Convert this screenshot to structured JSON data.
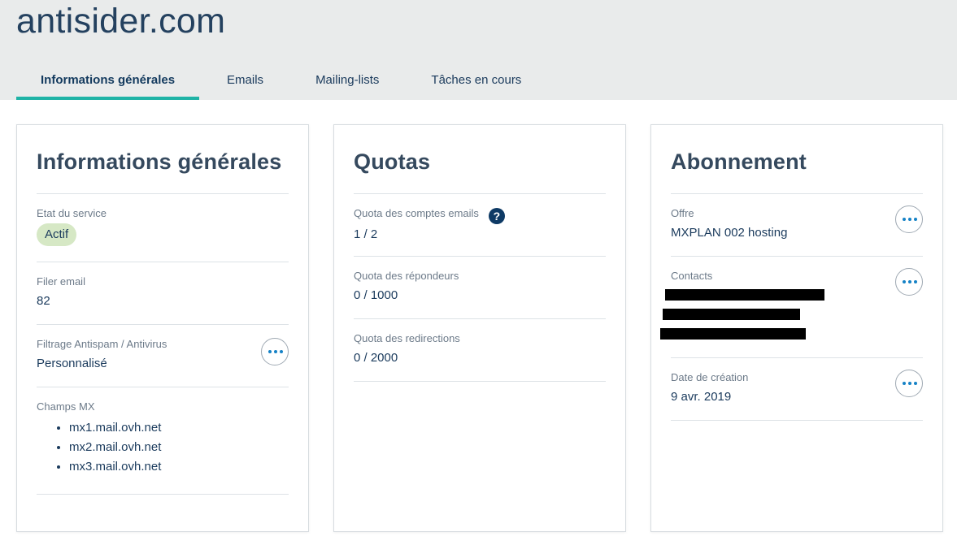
{
  "header": {
    "domain": "antisider.com",
    "tabs": [
      {
        "label": "Informations générales",
        "active": true
      },
      {
        "label": "Emails",
        "active": false
      },
      {
        "label": "Mailing-lists",
        "active": false
      },
      {
        "label": "Tâches en cours",
        "active": false
      }
    ]
  },
  "general": {
    "title": "Informations générales",
    "service_state": {
      "label": "Etat du service",
      "value": "Actif"
    },
    "filer": {
      "label": "Filer email",
      "value": "82"
    },
    "antispam": {
      "label": "Filtrage Antispam / Antivirus",
      "value": "Personnalisé"
    },
    "mx": {
      "label": "Champs MX",
      "values": [
        "mx1.mail.ovh.net",
        "mx2.mail.ovh.net",
        "mx3.mail.ovh.net"
      ]
    }
  },
  "quotas": {
    "title": "Quotas",
    "email_accounts": {
      "label": "Quota des comptes emails",
      "value": "1 / 2",
      "help": "?"
    },
    "responders": {
      "label": "Quota des répondeurs",
      "value": "0 / 1000"
    },
    "redirections": {
      "label": "Quota des redirections",
      "value": "0 / 2000"
    }
  },
  "subscription": {
    "title": "Abonnement",
    "offer": {
      "label": "Offre",
      "value": "MXPLAN 002 hosting"
    },
    "contacts": {
      "label": "Contacts"
    },
    "creation": {
      "label": "Date de création",
      "value": "9 avr. 2019"
    }
  },
  "colors": {
    "accent": "#1fb3a6",
    "active_badge": "#d6e8c5",
    "header_bg": "#e9ebeb",
    "action_dots": "#1582c6"
  },
  "icons": {
    "more": "more-actions-icon",
    "help": "help-icon"
  }
}
